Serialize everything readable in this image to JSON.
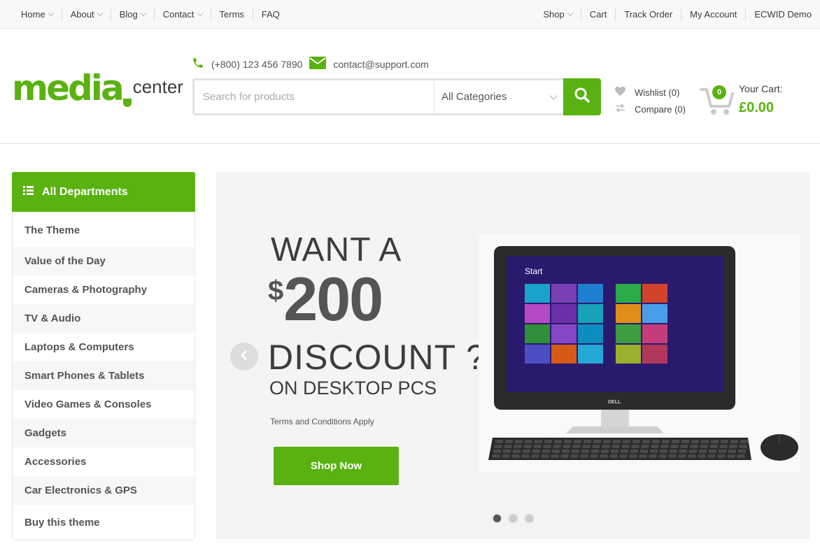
{
  "topbar": {
    "left": [
      {
        "label": "Home",
        "dropdown": true
      },
      {
        "label": "About",
        "dropdown": true
      },
      {
        "label": "Blog",
        "dropdown": true
      },
      {
        "label": "Contact",
        "dropdown": true
      },
      {
        "label": "Terms",
        "dropdown": false
      },
      {
        "label": "FAQ",
        "dropdown": false
      }
    ],
    "right": [
      {
        "label": "Shop",
        "dropdown": true
      },
      {
        "label": "Cart",
        "dropdown": false
      },
      {
        "label": "Track Order",
        "dropdown": false
      },
      {
        "label": "My Account",
        "dropdown": false
      },
      {
        "label": "ECWID Demo",
        "dropdown": false
      }
    ]
  },
  "header": {
    "logo": {
      "primary": "media",
      "secondary": "center"
    },
    "phone": "(+800) 123 456 7890",
    "email": "contact@support.com",
    "search": {
      "placeholder": "Search for products",
      "category": "All Categories"
    },
    "wishlist": "Wishlist (0)",
    "compare": "Compare (0)",
    "cart": {
      "count": "0",
      "label": "Your Cart:",
      "total": "£0.00"
    }
  },
  "sidebar": {
    "title": "All Departments",
    "items": [
      "The Theme",
      "Value of the Day",
      "Cameras & Photography",
      "TV & Audio",
      "Laptops & Computers",
      "Smart Phones & Tablets",
      "Video Games & Consoles",
      "Gadgets",
      "Accessories",
      "Car Electronics & GPS",
      "Buy this theme"
    ]
  },
  "hero": {
    "line1": "WANT A",
    "currency": "$",
    "amount": "200",
    "line3": "DISCOUNT ?",
    "line4": "ON DESKTOP PCS",
    "terms": "Terms and Conditions Apply",
    "cta": "Shop Now",
    "screen_label": "Start",
    "brand": "DELL",
    "slides": 3,
    "active_slide": 1
  },
  "colors": {
    "accent": "#59b210",
    "text": "#3d3d3d",
    "hero_bg": "#f4f4f4"
  }
}
